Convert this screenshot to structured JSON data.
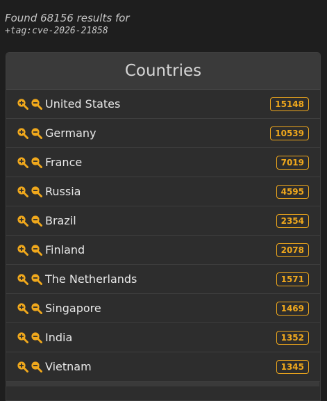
{
  "header": {
    "found_text": "Found 68156 results for",
    "query": "+tag:cve-2026-21858"
  },
  "panel": {
    "title": "Countries",
    "rows": [
      {
        "country": "United States",
        "count": "15148"
      },
      {
        "country": "Germany",
        "count": "10539"
      },
      {
        "country": "France",
        "count": "7019"
      },
      {
        "country": "Russia",
        "count": "4595"
      },
      {
        "country": "Brazil",
        "count": "2354"
      },
      {
        "country": "Finland",
        "count": "2078"
      },
      {
        "country": "The Netherlands",
        "count": "1571"
      },
      {
        "country": "Singapore",
        "count": "1469"
      },
      {
        "country": "India",
        "count": "1352"
      },
      {
        "country": "Vietnam",
        "count": "1345"
      }
    ]
  },
  "icons": {
    "include": "zoom-in-icon",
    "exclude": "zoom-out-icon"
  },
  "colors": {
    "accent": "#f0a81c",
    "background": "#1e1e1e",
    "panel": "#2d2d2d"
  }
}
